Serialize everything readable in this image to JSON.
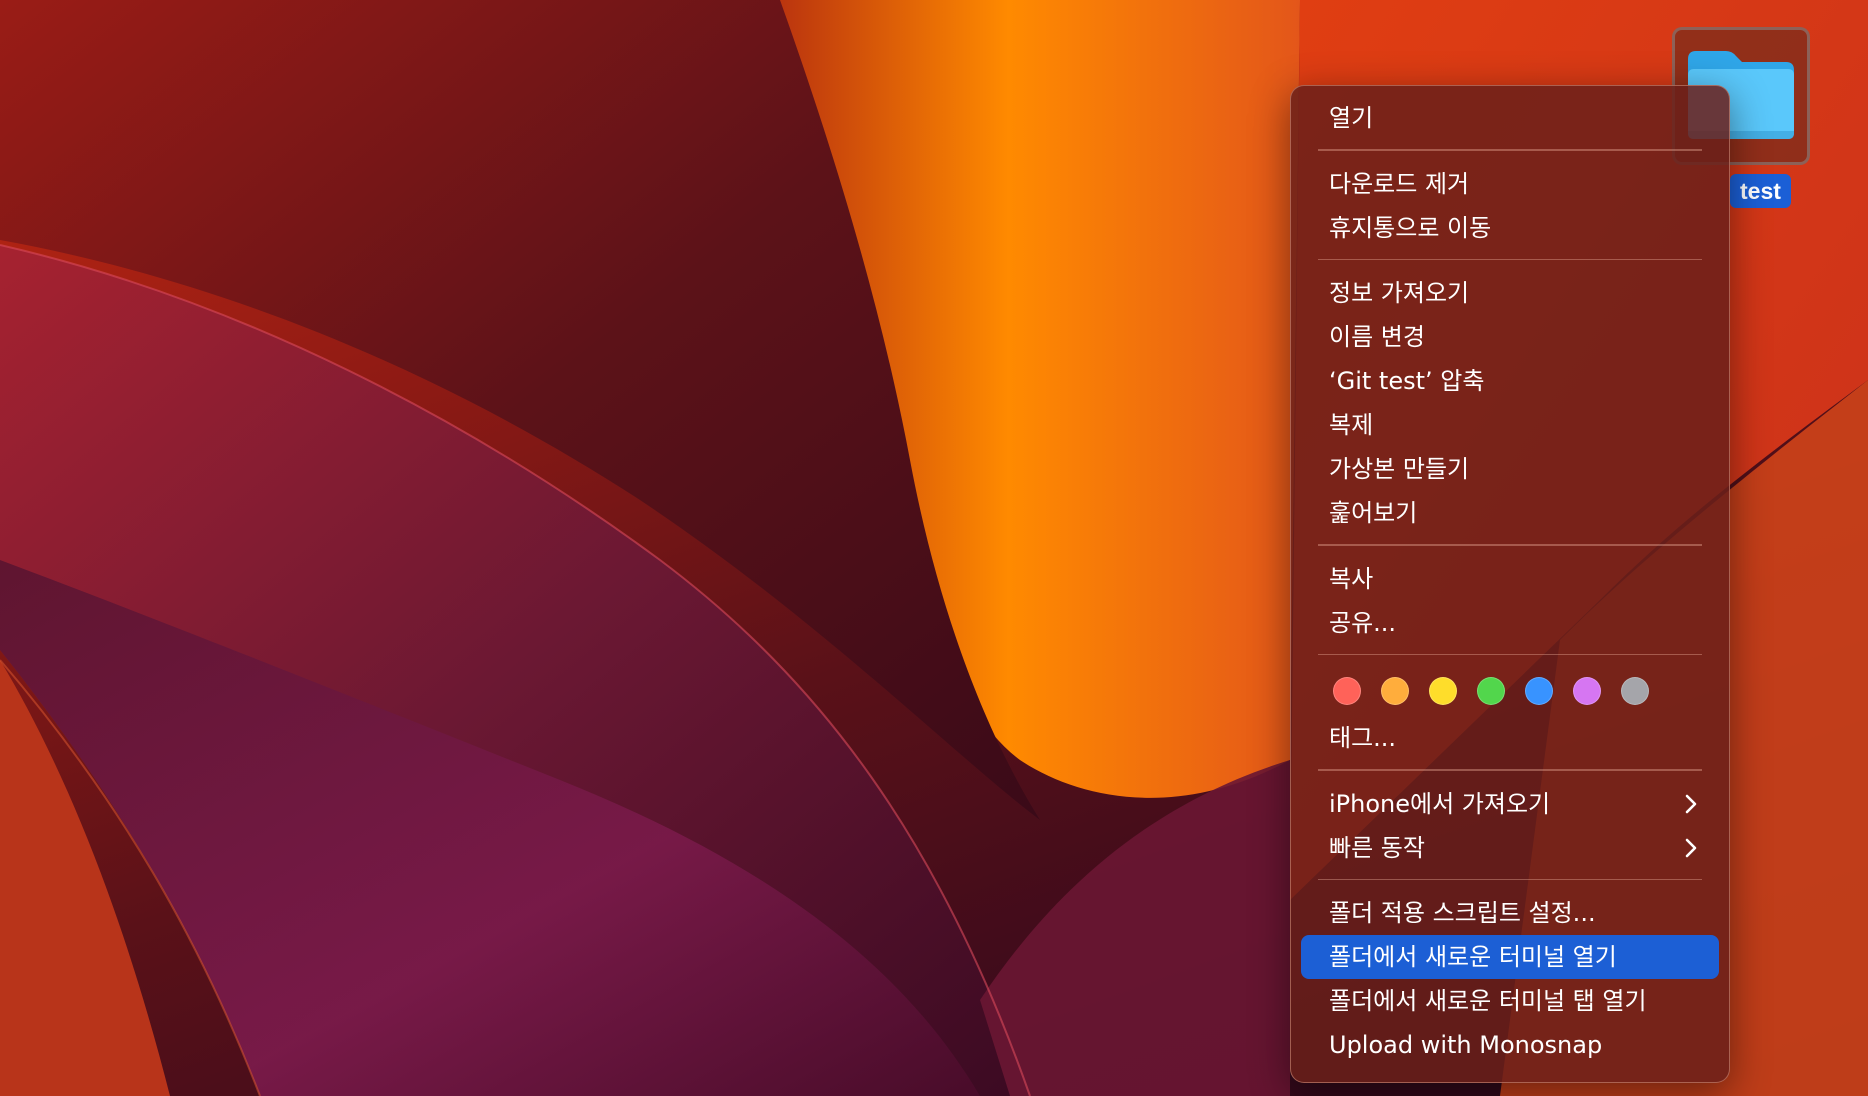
{
  "desktop": {
    "folder_name": "test"
  },
  "context_menu": {
    "items": [
      {
        "label": "열기"
      },
      {
        "label": "다운로드 제거"
      },
      {
        "label": "휴지통으로 이동"
      },
      {
        "label": "정보 가져오기"
      },
      {
        "label": "이름 변경"
      },
      {
        "label": "‘Git test’ 압축"
      },
      {
        "label": "복제"
      },
      {
        "label": "가상본 만들기"
      },
      {
        "label": "훑어보기"
      },
      {
        "label": "복사"
      },
      {
        "label": "공유..."
      },
      {
        "label": "태그..."
      },
      {
        "label": "iPhone에서 가져오기",
        "submenu": true
      },
      {
        "label": "빠른 동작",
        "submenu": true
      },
      {
        "label": "폴더 적용 스크립트 설정..."
      },
      {
        "label": "폴더에서 새로운 터미널 열기",
        "highlighted": true
      },
      {
        "label": "폴더에서 새로운 터미널 탭 열기"
      },
      {
        "label": "Upload with Monosnap"
      }
    ],
    "tag_colors": [
      {
        "name": "red",
        "color": "#ff6259"
      },
      {
        "name": "orange",
        "color": "#ffad3c"
      },
      {
        "name": "yellow",
        "color": "#fedd2b"
      },
      {
        "name": "green",
        "color": "#52d64c"
      },
      {
        "name": "blue",
        "color": "#3893ff"
      },
      {
        "name": "purple",
        "color": "#d676f2"
      },
      {
        "name": "gray",
        "color": "#a5a5aa"
      }
    ],
    "highlight_color": "#1c5fd5"
  }
}
